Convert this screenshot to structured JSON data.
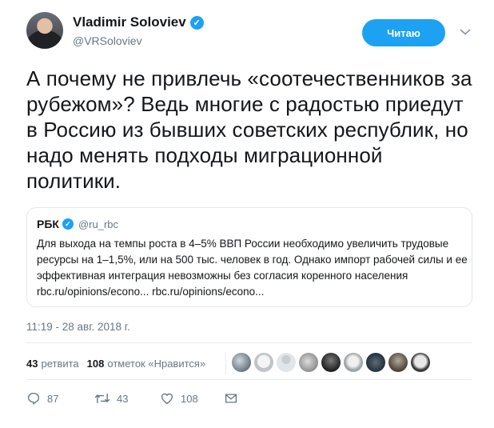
{
  "tweet": {
    "author": {
      "name": "Vladimir Soloviev",
      "handle": "@VRSoloviev",
      "verified": true
    },
    "follow_button": "Читаю",
    "text": "А почему не привлечь «соотечественников за рубежом»? Ведь многие с радостью приедут в Россию из бывших советских республик, но надо менять подходы миграционной политики.",
    "quoted": {
      "name": "РБК",
      "handle": "@ru_rbc",
      "verified": true,
      "text": "Для выхода на темпы роста в 4–5% ВВП России необходимо увеличить трудовые ресурсы на 1–1,5%, или на 500 тыс. человек в год. Однако импорт рабочей силы и ее эффективная интеграция невозможны без согласия коренного населения",
      "links": "rbc.ru/opinions/econo... rbc.ru/opinions/econo..."
    },
    "timestamp": "11:19 - 28 авг. 2018 г.",
    "stats": {
      "retweets_count": "43",
      "retweets_label": "ретвита",
      "likes_count": "108",
      "likes_label": "отметок «Нравится»"
    },
    "liker_avatars": 9,
    "actions": {
      "replies": "87",
      "retweets": "43",
      "likes": "108"
    }
  },
  "colors": {
    "accent": "#1da1f2",
    "text": "#14171a",
    "muted": "#657786",
    "border": "#e1e8ed"
  },
  "icons": [
    "verified-icon",
    "chevron-down-icon",
    "reply-icon",
    "retweet-icon",
    "like-icon",
    "message-icon"
  ]
}
